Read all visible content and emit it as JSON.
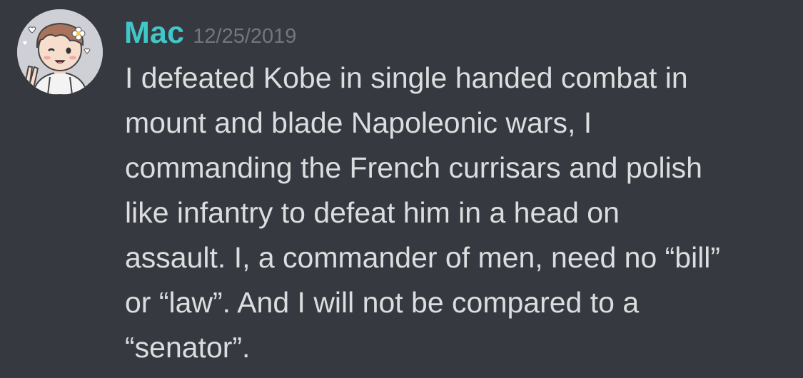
{
  "message": {
    "author": "Mac",
    "timestamp": "12/25/2019",
    "lines": [
      "I defeated Kobe in single handed combat in",
      "mount and blade Napoleonic wars, I",
      "commanding the French currisars and polish",
      "like infantry to defeat him in a head on",
      "assault. I, a commander of men, need no “bill”",
      "or “law”. And I will not be compared to a",
      "“senator”."
    ]
  },
  "colors": {
    "background": "#36393f",
    "username": "#41c7c7",
    "timestamp": "#72767d",
    "text": "#dcddde"
  },
  "avatar": {
    "icon": "cartoon-person-avatar"
  }
}
